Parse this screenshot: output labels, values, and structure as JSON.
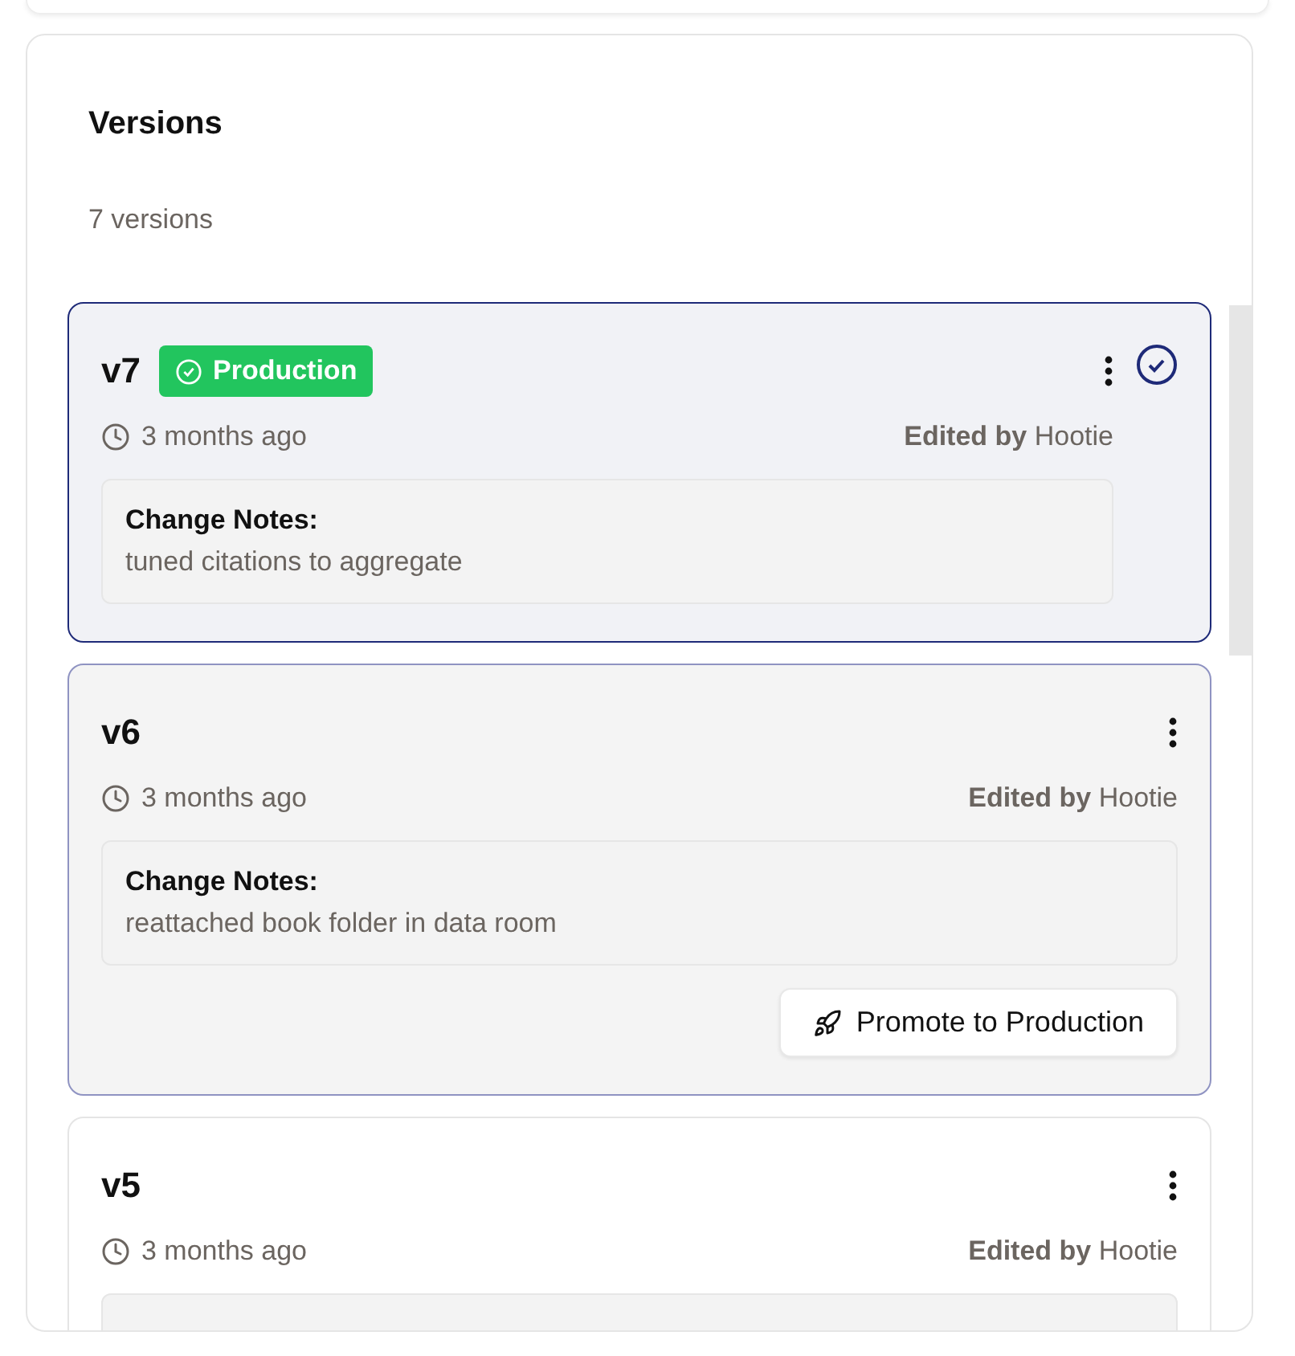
{
  "panel": {
    "title": "Versions",
    "count": "7 versions"
  },
  "versions": [
    {
      "label": "v7",
      "badge": "Production",
      "selected": true,
      "hovered": false,
      "time": "3 months ago",
      "edited": "**Edited by** Hootie",
      "notes_label": "Change Notes:",
      "notes": "tuned citations to aggregate"
    },
    {
      "label": "v6",
      "selected": false,
      "hovered": true,
      "time": "3 months ago",
      "edited": "**Edited by** Hootie",
      "notes_label": "Change Notes:",
      "notes": "reattached book folder in data room",
      "action": "Promote to Production"
    },
    {
      "label": "v5",
      "selected": false,
      "hovered": false,
      "time": "3 months ago",
      "edited": "**Edited by** Hootie"
    }
  ]
}
